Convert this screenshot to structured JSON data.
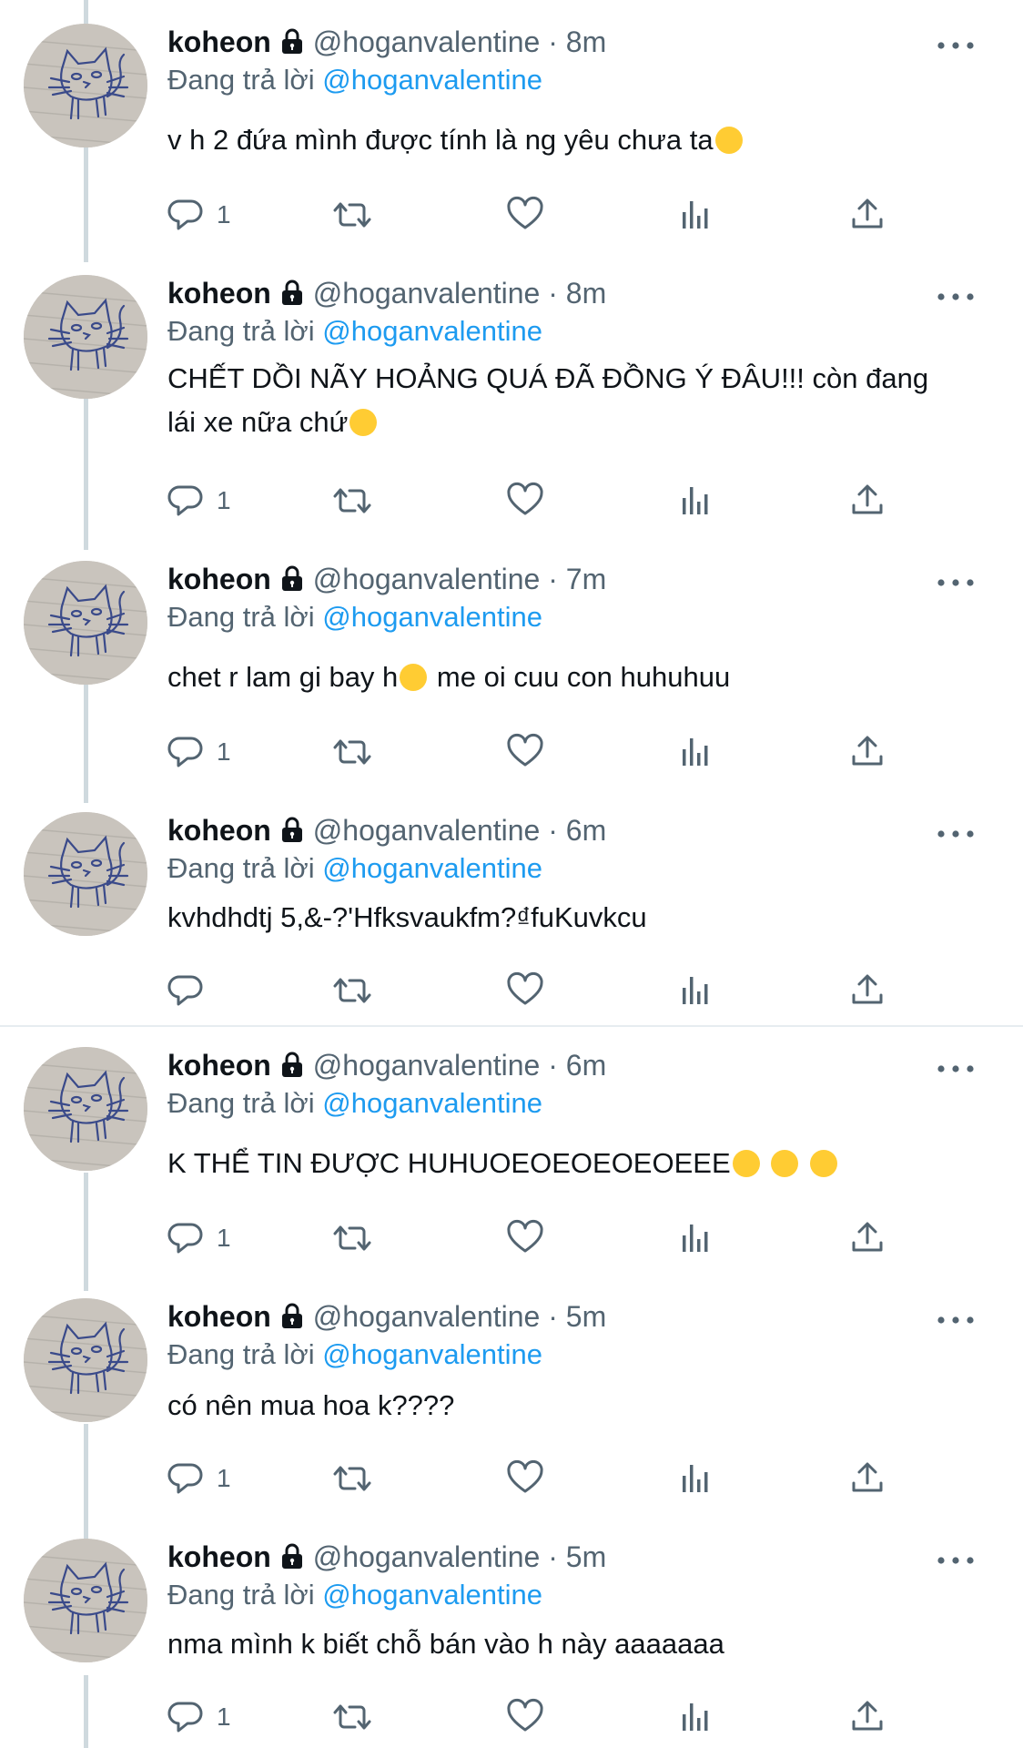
{
  "tweets": [
    {
      "name": "koheon",
      "handle": "@hoganvalentine",
      "dot": "·",
      "time": "8m",
      "reply_prefix": "Đang trả lời",
      "reply_to": "@hoganvalentine",
      "text": "v h 2 đứa mình được tính là ng yêu chưa ta",
      "emojis": [
        "smiling-face"
      ],
      "reply_count": "1"
    },
    {
      "name": "koheon",
      "handle": "@hoganvalentine",
      "dot": "·",
      "time": "8m",
      "reply_prefix": "Đang trả lời",
      "reply_to": "@hoganvalentine",
      "text_line1": "CHẾT DỒI NÃY HOẢNG QUÁ ĐÃ ĐỒNG Ý ĐÂU!!! còn đang",
      "text_line2": "lái xe nữa chứ",
      "emojis": [
        "disappointed-face"
      ],
      "reply_count": "1"
    },
    {
      "name": "koheon",
      "handle": "@hoganvalentine",
      "dot": "·",
      "time": "7m",
      "reply_prefix": "Đang trả lời",
      "reply_to": "@hoganvalentine",
      "text_before": "chet r lam gi bay h",
      "text_after": " me oi cuu con huhuhuu",
      "emojis": [
        "pleading-face"
      ],
      "reply_count": "1"
    },
    {
      "name": "koheon",
      "handle": "@hoganvalentine",
      "dot": "·",
      "time": "6m",
      "reply_prefix": "Đang trả lời",
      "reply_to": "@hoganvalentine",
      "text": "kvhdhdtj 5,&-?'Hfksvaukfm?₫fuKuvkcu",
      "reply_count": ""
    },
    {
      "name": "koheon",
      "handle": "@hoganvalentine",
      "dot": "·",
      "time": "6m",
      "reply_prefix": "Đang trả lời",
      "reply_to": "@hoganvalentine",
      "text": "K THỂ TIN ĐƯỢC HUHUOEOEOEOEOEEE",
      "emojis": [
        "screaming-face",
        "fearful-face",
        "anxious-face"
      ],
      "reply_count": "1"
    },
    {
      "name": "koheon",
      "handle": "@hoganvalentine",
      "dot": "·",
      "time": "5m",
      "reply_prefix": "Đang trả lời",
      "reply_to": "@hoganvalentine",
      "text": "có nên mua hoa k????",
      "reply_count": "1"
    },
    {
      "name": "koheon",
      "handle": "@hoganvalentine",
      "dot": "·",
      "time": "5m",
      "reply_prefix": "Đang trả lời",
      "reply_to": "@hoganvalentine",
      "text": "nma mình k biết chỗ bán vào h này aaaaaaa",
      "reply_count": "1"
    }
  ],
  "colors": {
    "link": "#1d9bf0",
    "secondary": "#536471",
    "text": "#0f1419",
    "thread_line": "#cfd9de"
  },
  "icons": [
    "lock-icon",
    "more-icon",
    "reply-icon",
    "retweet-icon",
    "like-icon",
    "analytics-icon",
    "share-icon"
  ]
}
